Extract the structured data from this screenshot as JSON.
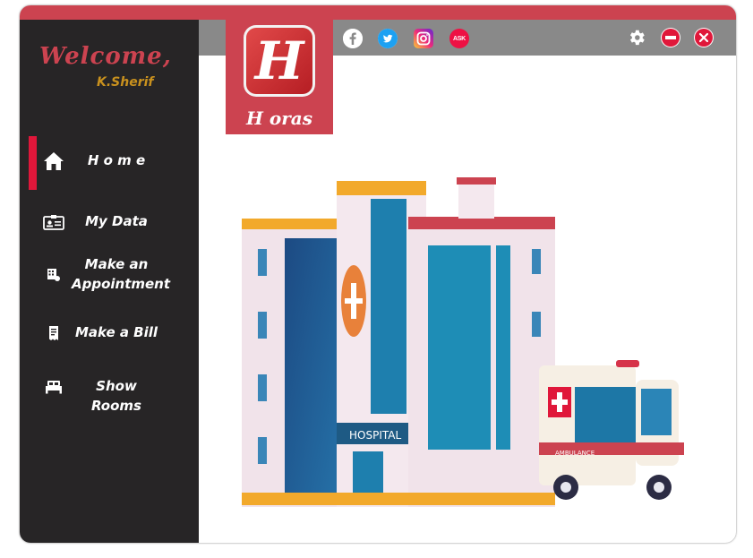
{
  "sidebar": {
    "welcome": "Welcome,",
    "username": "K.Sherif",
    "items": [
      {
        "label": "H o m e",
        "icon": "home-icon"
      },
      {
        "label": "My Data",
        "icon": "id-card-icon"
      },
      {
        "label": "Make an Appointment",
        "icon": "calendar-grid-icon"
      },
      {
        "label": "Make a Bill",
        "icon": "receipt-icon"
      },
      {
        "label": "Show Rooms",
        "icon": "bed-icon"
      }
    ]
  },
  "logo": {
    "letter": "H",
    "text": "H oras"
  },
  "social": [
    {
      "name": "facebook-icon",
      "glyph": "f",
      "color": "#ffffff"
    },
    {
      "name": "twitter-icon",
      "glyph": "t",
      "color": "#1da1f2"
    },
    {
      "name": "instagram-icon",
      "glyph": "◎",
      "color": "#d6249f"
    },
    {
      "name": "askfm-icon",
      "glyph": "ASK",
      "color": "#ee1144"
    }
  ],
  "controls": [
    {
      "name": "settings-icon"
    },
    {
      "name": "minimize-icon"
    },
    {
      "name": "close-icon"
    }
  ],
  "illustration": {
    "hospital_sign": "HOSPITAL",
    "ambulance_label": "AMBULANCE"
  },
  "colors": {
    "accent": "#cc4350",
    "sidebar": "#272526",
    "topbar": "#898989",
    "username": "#c9911e",
    "active_indicator": "#e0173a"
  }
}
